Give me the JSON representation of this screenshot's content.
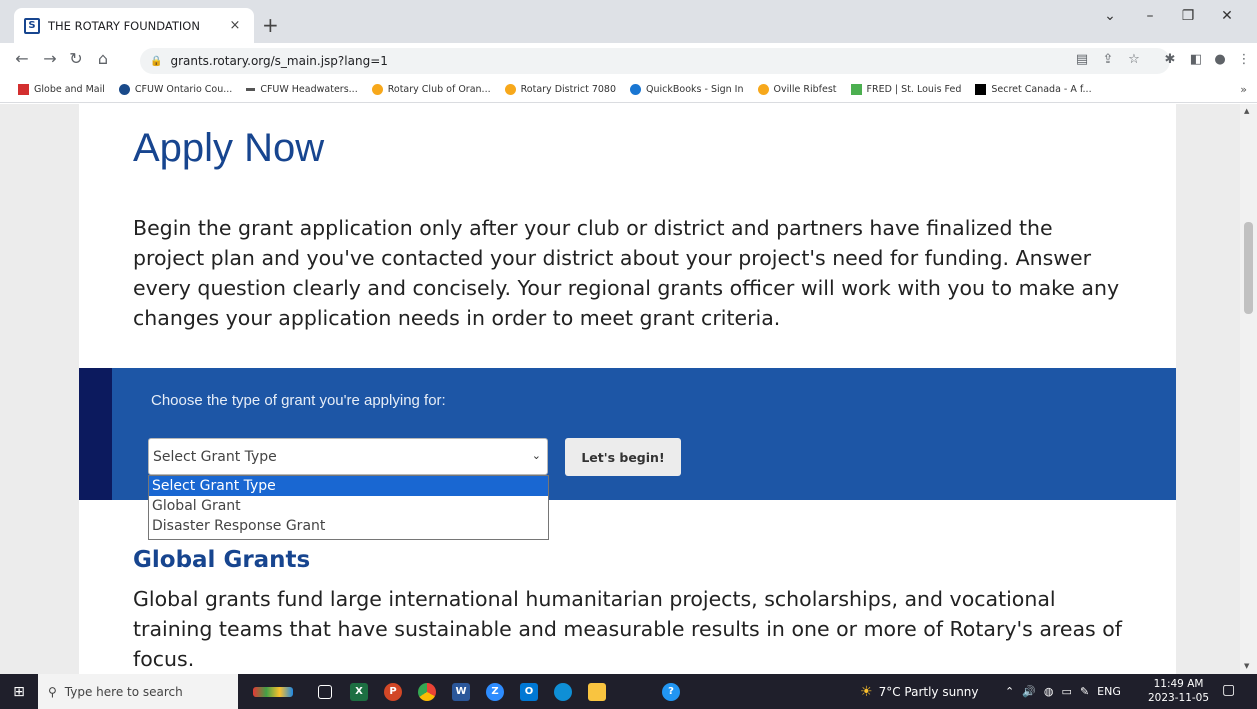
{
  "browser": {
    "tab_title": "THE ROTARY FOUNDATION",
    "tab_close": "×",
    "new_tab": "+",
    "favicon_text": "S",
    "url": "grants.rotary.org/s_main.jsp?lang=1",
    "bookmarks": [
      "Globe and Mail",
      "CFUW Ontario Cou...",
      "CFUW Headwaters...",
      "Rotary Club of Oran...",
      "Rotary District 7080",
      "QuickBooks - Sign In",
      "Oville Ribfest",
      "FRED | St. Louis Fed",
      "Secret Canada - A f..."
    ],
    "bookmarks_more": "»"
  },
  "page": {
    "heading": "Apply Now",
    "intro": "Begin the grant application only after your club or district and partners have finalized the project plan and you've contacted your district about your project's need for funding. Answer every question clearly and concisely. Your regional grants officer will work with you to make any changes your application needs in order to meet grant criteria.",
    "grant_prompt": "Choose the type of grant you're applying for:",
    "select_value": "Select Grant Type",
    "select_options": [
      "Select Grant Type",
      "Global Grant",
      "Disaster Response Grant"
    ],
    "begin_button": "Let's begin!",
    "global_heading": "Global Grants",
    "global_text": "Global grants fund large international humanitarian projects, scholarships, and vocational training teams that have sustainable and measurable results in one or more of Rotary's areas of focus."
  },
  "taskbar": {
    "search_placeholder": "Type here to search",
    "weather": "7°C  Partly sunny",
    "lang": "ENG",
    "time": "11:49 AM",
    "date": "2023-11-05"
  },
  "colors": {
    "rotary_blue": "#17458f",
    "band_blue": "#1d56a6",
    "band_edge": "#0c1a5e",
    "selected_option": "#1967d2"
  }
}
